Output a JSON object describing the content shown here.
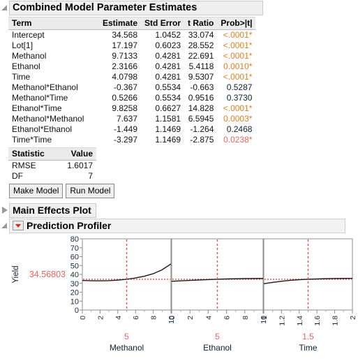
{
  "panels": {
    "combined_title": "Combined Model Parameter Estimates",
    "main_effects_title": "Main Effects Plot",
    "profiler_title": "Prediction Profiler"
  },
  "estimates_table": {
    "columns": [
      "Term",
      "Estimate",
      "Std Error",
      "t Ratio",
      "Prob>|t|"
    ],
    "rows": [
      {
        "term": "Intercept",
        "estimate": "34.568",
        "std_error": "1.0452",
        "t_ratio": "33.074",
        "prob": "<.0001*",
        "prob_style": "sig-orange"
      },
      {
        "term": "Lot[1]",
        "estimate": "17.197",
        "std_error": "0.6023",
        "t_ratio": "28.552",
        "prob": "<.0001*",
        "prob_style": "sig-orange"
      },
      {
        "term": "Methanol",
        "estimate": "9.7133",
        "std_error": "0.4281",
        "t_ratio": "22.691",
        "prob": "<.0001*",
        "prob_style": "sig-orange"
      },
      {
        "term": "Ethanol",
        "estimate": "2.3166",
        "std_error": "0.4281",
        "t_ratio": "5.4118",
        "prob": "0.0010*",
        "prob_style": "sig-orange"
      },
      {
        "term": "Time",
        "estimate": "4.0798",
        "std_error": "0.4281",
        "t_ratio": "9.5307",
        "prob": "<.0001*",
        "prob_style": "sig-orange"
      },
      {
        "term": "Methanol*Ethanol",
        "estimate": "-0.367",
        "std_error": "0.5534",
        "t_ratio": "-0.663",
        "prob": "0.5287",
        "prob_style": "nonsig"
      },
      {
        "term": "Methanol*Time",
        "estimate": "0.5266",
        "std_error": "0.5534",
        "t_ratio": "0.9516",
        "prob": "0.3730",
        "prob_style": "nonsig"
      },
      {
        "term": "Ethanol*Time",
        "estimate": "9.8258",
        "std_error": "0.6627",
        "t_ratio": "14.828",
        "prob": "<.0001*",
        "prob_style": "sig-orange"
      },
      {
        "term": "Methanol*Methanol",
        "estimate": "7.637",
        "std_error": "1.1581",
        "t_ratio": "6.5945",
        "prob": "0.0003*",
        "prob_style": "sig-orange"
      },
      {
        "term": "Ethanol*Ethanol",
        "estimate": "-1.449",
        "std_error": "1.1469",
        "t_ratio": "-1.264",
        "prob": "0.2468",
        "prob_style": "nonsig"
      },
      {
        "term": "Time*Time",
        "estimate": "-3.297",
        "std_error": "1.1469",
        "t_ratio": "-2.875",
        "prob": "0.0238*",
        "prob_style": "sig-red"
      }
    ]
  },
  "stats_table": {
    "columns": [
      "Statistic",
      "Value"
    ],
    "rows": [
      {
        "statistic": "RMSE",
        "value": "1.6017"
      },
      {
        "statistic": "DF",
        "value": "7"
      }
    ]
  },
  "buttons": {
    "make_model": "Make Model",
    "run_model": "Run Model"
  },
  "chart_data": {
    "type": "line",
    "title": "Prediction Profiler",
    "ylabel": "Yield",
    "ylim": [
      0,
      80
    ],
    "yticks": [
      0,
      10,
      20,
      30,
      40,
      50,
      60,
      70,
      80
    ],
    "prediction_value": "34.56803",
    "prediction_y": 34.56803,
    "panels": [
      {
        "name": "Methanol",
        "xlabel": "Methanol",
        "xlim": [
          0,
          10
        ],
        "xticks": [
          "0",
          "2",
          "4",
          "6",
          "8",
          "10"
        ],
        "current_value": "5",
        "current_x": 5,
        "curve": [
          {
            "x": 0,
            "y": 33.2
          },
          {
            "x": 1,
            "y": 32.9
          },
          {
            "x": 2,
            "y": 32.8
          },
          {
            "x": 3,
            "y": 33.0
          },
          {
            "x": 4,
            "y": 33.6
          },
          {
            "x": 5,
            "y": 34.57
          },
          {
            "x": 6,
            "y": 36.0
          },
          {
            "x": 7,
            "y": 38.0
          },
          {
            "x": 8,
            "y": 40.8
          },
          {
            "x": 9,
            "y": 45.2
          },
          {
            "x": 10,
            "y": 51.8
          }
        ]
      },
      {
        "name": "Ethanol",
        "xlabel": "Ethanol",
        "xlim": [
          0,
          10
        ],
        "xticks": [
          "0",
          "2",
          "4",
          "6",
          "8",
          "10"
        ],
        "current_value": "5",
        "current_x": 5,
        "curve": [
          {
            "x": 0,
            "y": 32.3
          },
          {
            "x": 2,
            "y": 33.3
          },
          {
            "x": 4,
            "y": 34.2
          },
          {
            "x": 5,
            "y": 34.57
          },
          {
            "x": 6,
            "y": 34.9
          },
          {
            "x": 8,
            "y": 35.3
          },
          {
            "x": 10,
            "y": 35.5
          }
        ]
      },
      {
        "name": "Time",
        "xlabel": "Time",
        "xlim": [
          1,
          2
        ],
        "xticks": [
          "1",
          "1.2",
          "1.4",
          "1.6",
          "1.8",
          "2"
        ],
        "current_value": "1.5",
        "current_x": 1.5,
        "curve": [
          {
            "x": 1.0,
            "y": 29.6
          },
          {
            "x": 1.1,
            "y": 31.0
          },
          {
            "x": 1.2,
            "y": 32.3
          },
          {
            "x": 1.3,
            "y": 33.4
          },
          {
            "x": 1.4,
            "y": 34.1
          },
          {
            "x": 1.5,
            "y": 34.57
          },
          {
            "x": 1.6,
            "y": 34.9
          },
          {
            "x": 1.7,
            "y": 35.2
          },
          {
            "x": 1.8,
            "y": 35.4
          },
          {
            "x": 1.9,
            "y": 35.5
          },
          {
            "x": 2.0,
            "y": 35.55
          }
        ]
      }
    ]
  }
}
